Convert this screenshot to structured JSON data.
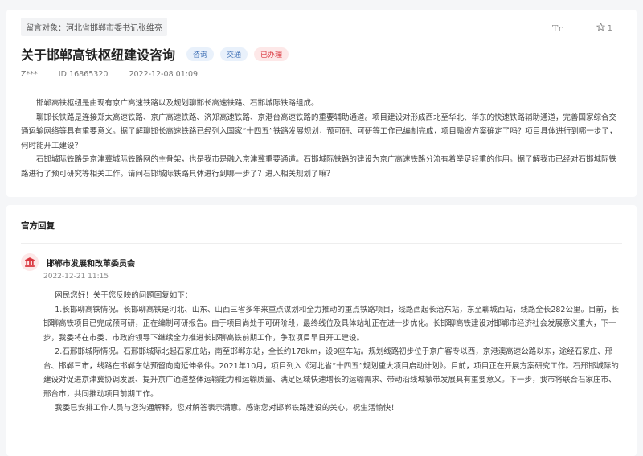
{
  "message": {
    "recipient": "留言对象：河北省邯郸市委书记张维亮",
    "font_tool_label": "Tr",
    "like_count": "1",
    "title": "关于邯郸高铁枢纽建设咨询",
    "tags": [
      "咨询",
      "交通",
      "已办理"
    ],
    "author": "Z***",
    "id": "ID:16865320",
    "datetime": "2022-12-08 01:09",
    "paragraphs": [
      "邯郸高铁枢纽是由现有京广高速铁路以及规划聊邯长高速铁路、石邯城际铁路组成。",
      "聊邯长铁路是连接郑太高速铁路、京广高速铁路、济郑高速铁路、京港台高速铁路的重要辅助通道。项目建设对形成西北至华北、华东的快速铁路辅助通道，完善国家综合交通运输网络等具有重要意义。据了解聊邯长高速铁路已经列入国家“十四五”铁路发展规划，预可研、可研等工作已编制完成，项目融资方案确定了吗？项目具体进行到哪一步了，何时能开工建设？",
      "石邯城际铁路是京津冀城际铁路网的主骨架，也是我市是融入京津冀重要通道。石邯城际铁路的建设为京广高速铁路分流有着举足轻重的作用。据了解我市已经对石邯城际铁路进行了预可研究等相关工作。请问石邯城际铁路具体进行到哪一步了？进入相关规划了嘛？"
    ]
  },
  "reply": {
    "section_title": "官方回复",
    "department": "邯郸市发展和改革委员会",
    "datetime": "2022-12-21 11:15",
    "paragraphs": [
      "网民您好！关于您反映的问题回复如下：",
      "1.长邯聊高铁情况。长邯聊高铁是河北、山东、山西三省多年来重点谋划和全力推动的重点铁路项目，线路西起长治东站，东至聊城西站，线路全长282公里。目前，长邯聊高铁项目已完成预可研，正在编制可研报告。由于项目尚处于可研阶段，最终线位及具体站址正在进一步优化。长邯聊高铁建设对邯郸市经济社会发展意义重大，下一步，我委将在市委、市政府领导下继续全力推进长邯聊高铁前期工作，争取项目早日开工建设。",
      "2.石邢邯城际情况。石邢邯城际北起石家庄站，南至邯郸东站，全长约178km，设9座车站。规划线路初步位于京广客专以西，京港澳高速公路以东，途经石家庄、邢台、邯郸三市，线路在邯郸东站预留向南延伸条件。2021年10月，项目列入《河北省“十四五”规划重大项目启动计划》。目前，项目正在开展方案研究工作。石邢邯城际的建设对促进京津冀协调发展、提升京广通道整体运输能力和运输质量、满足区域快速增长的运输需求、带动沿线城镇带发展具有重要意义。下一步，我市将联合石家庄市、邢台市，共同推动项目前期工作。",
      "我委已安排工作人员与您沟通解释，您对解答表示满意。感谢您对邯郸铁路建设的关心，祝生活愉快！"
    ]
  }
}
